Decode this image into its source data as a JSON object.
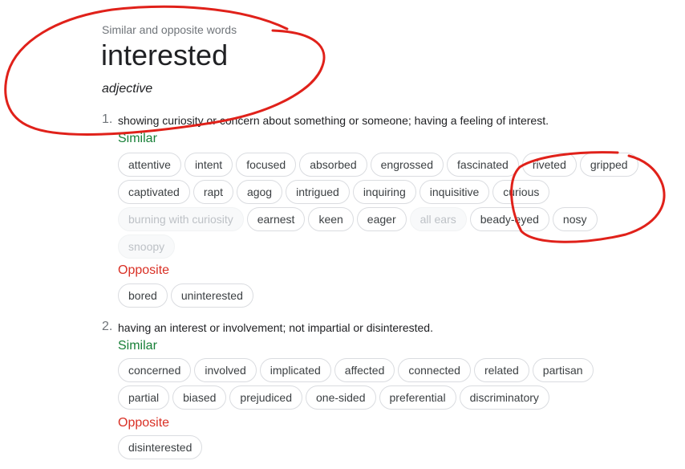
{
  "header": {
    "subtitle": "Similar and opposite words",
    "word": "interested",
    "part_of_speech": "adjective"
  },
  "senses": [
    {
      "number": "1.",
      "definition": "showing curiosity or concern about something or someone; having a feeling of interest.",
      "similar_label": "Similar",
      "similar": [
        {
          "text": "attentive",
          "faded": false
        },
        {
          "text": "intent",
          "faded": false
        },
        {
          "text": "focused",
          "faded": false
        },
        {
          "text": "absorbed",
          "faded": false
        },
        {
          "text": "engrossed",
          "faded": false
        },
        {
          "text": "fascinated",
          "faded": false
        },
        {
          "text": "riveted",
          "faded": false
        },
        {
          "text": "gripped",
          "faded": false
        },
        {
          "text": "captivated",
          "faded": false
        },
        {
          "text": "rapt",
          "faded": false
        },
        {
          "text": "agog",
          "faded": false
        },
        {
          "text": "intrigued",
          "faded": false
        },
        {
          "text": "inquiring",
          "faded": false
        },
        {
          "text": "inquisitive",
          "faded": false
        },
        {
          "text": "curious",
          "faded": false
        },
        {
          "text": "burning with curiosity",
          "faded": true
        },
        {
          "text": "earnest",
          "faded": false
        },
        {
          "text": "keen",
          "faded": false
        },
        {
          "text": "eager",
          "faded": false
        },
        {
          "text": "all ears",
          "faded": true
        },
        {
          "text": "beady-eyed",
          "faded": false
        },
        {
          "text": "nosy",
          "faded": false
        },
        {
          "text": "snoopy",
          "faded": true
        }
      ],
      "opposite_label": "Opposite",
      "opposite": [
        {
          "text": "bored",
          "faded": false
        },
        {
          "text": "uninterested",
          "faded": false
        }
      ]
    },
    {
      "number": "2.",
      "definition": "having an interest or involvement; not impartial or disinterested.",
      "similar_label": "Similar",
      "similar": [
        {
          "text": "concerned",
          "faded": false
        },
        {
          "text": "involved",
          "faded": false
        },
        {
          "text": "implicated",
          "faded": false
        },
        {
          "text": "affected",
          "faded": false
        },
        {
          "text": "connected",
          "faded": false
        },
        {
          "text": "related",
          "faded": false
        },
        {
          "text": "partisan",
          "faded": false
        },
        {
          "text": "partial",
          "faded": false
        },
        {
          "text": "biased",
          "faded": false
        },
        {
          "text": "prejudiced",
          "faded": false
        },
        {
          "text": "one-sided",
          "faded": false
        },
        {
          "text": "preferential",
          "faded": false
        },
        {
          "text": "discriminatory",
          "faded": false
        }
      ],
      "opposite_label": "Opposite",
      "opposite": [
        {
          "text": "disinterested",
          "faded": false
        }
      ]
    }
  ],
  "colors": {
    "similar": "#188038",
    "opposite": "#d93025",
    "annotation": "#e0211a"
  }
}
